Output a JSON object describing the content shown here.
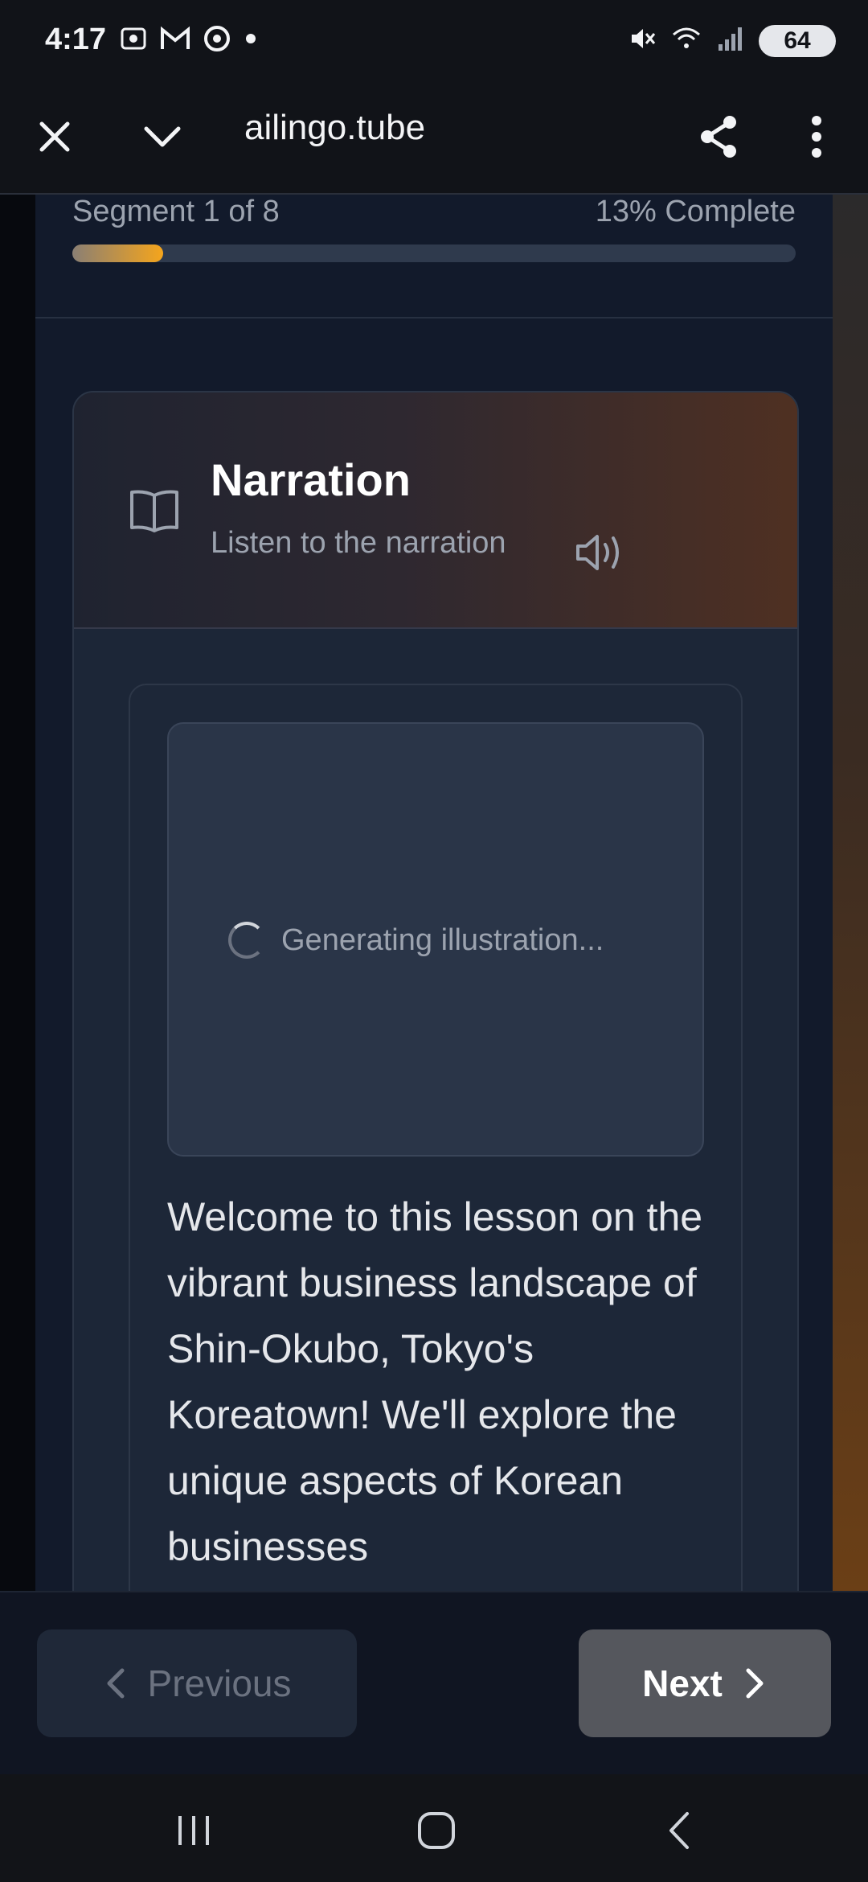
{
  "status_bar": {
    "time": "4:17",
    "battery": "64",
    "left_icons": [
      "screenshot-icon",
      "gmail-icon",
      "chrome-icon",
      "dot-icon"
    ],
    "right_icons": [
      "mute-icon",
      "wifi-icon",
      "signal-icon",
      "battery-icon"
    ]
  },
  "browser": {
    "url": "ailingo.tube"
  },
  "progress": {
    "segment_label": "Segment 1 of 8",
    "complete_label": "13% Complete",
    "fraction": 0.125
  },
  "card": {
    "title": "Narration",
    "subtitle": "Listen to the narration",
    "loading_text": "Generating illustration...",
    "narration": "Welcome to this lesson on the vibrant business landscape of Shin-Okubo, Tokyo's Koreatown! We'll explore the unique aspects of Korean businesses"
  },
  "nav": {
    "previous_label": "Previous",
    "next_label": "Next"
  },
  "colors": {
    "accent": "#f5a51c",
    "background": "#0f1422",
    "card": "#1c2637"
  }
}
